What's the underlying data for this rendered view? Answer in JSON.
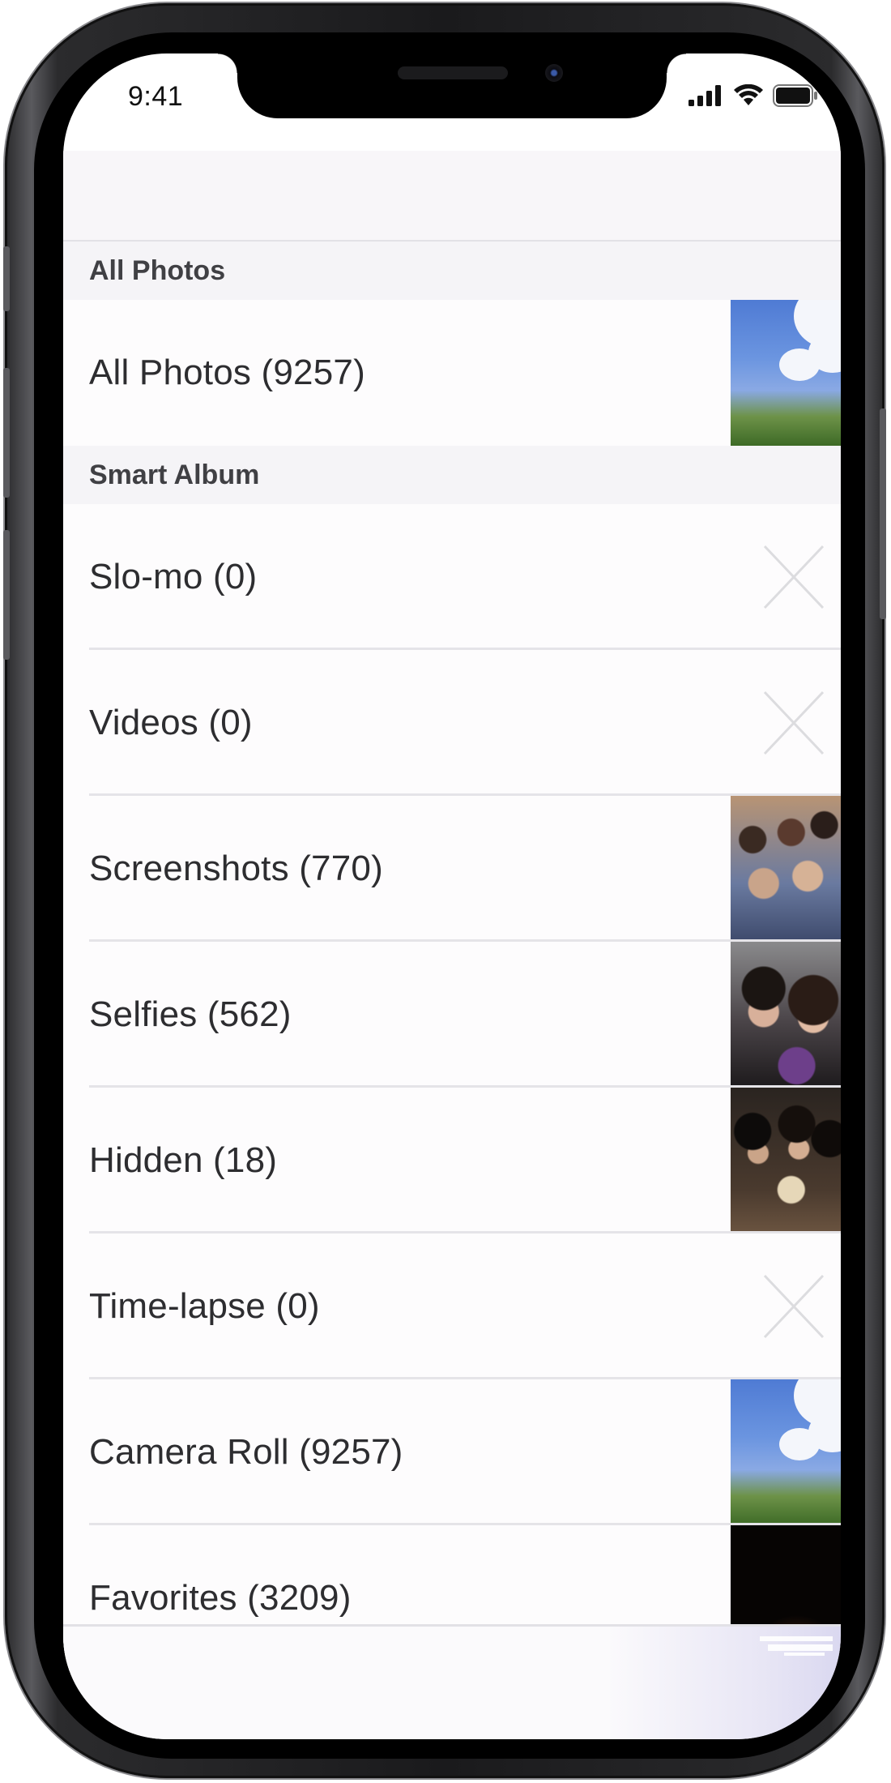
{
  "status_bar": {
    "time": "9:41"
  },
  "sections": [
    {
      "header": "All Photos",
      "rows": [
        {
          "label": "All Photos (9257)",
          "thumb": "sky"
        }
      ]
    },
    {
      "header": "Smart Album",
      "rows": [
        {
          "label": "Slo-mo (0)",
          "thumb": "placeholder-x"
        },
        {
          "label": "Videos (0)",
          "thumb": "placeholder-x"
        },
        {
          "label": "Screenshots (770)",
          "thumb": "group"
        },
        {
          "label": "Selfies (562)",
          "thumb": "selfie"
        },
        {
          "label": "Hidden (18)",
          "thumb": "hidden"
        },
        {
          "label": "Time-lapse (0)",
          "thumb": "placeholder-x"
        },
        {
          "label": "Camera Roll (9257)",
          "thumb": "sky"
        },
        {
          "label": "Favorites (3209)",
          "thumb": "fav"
        }
      ]
    }
  ],
  "icons": {
    "signal": "cellular-signal-icon",
    "wifi": "wifi-icon",
    "battery": "battery-icon",
    "empty_thumb": "close-x-icon"
  },
  "colors": {
    "section_bg": "#f5f4f7",
    "separator": "#e5e4e8",
    "label": "#2d2d30"
  }
}
